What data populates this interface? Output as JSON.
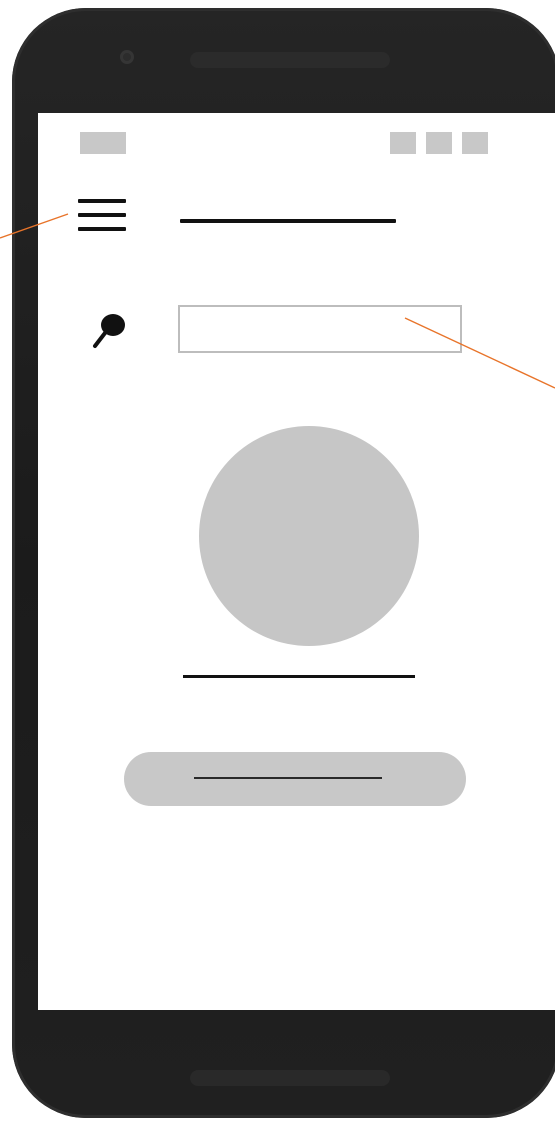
{
  "wireframe": {
    "device": "android-phone",
    "status_bar": {
      "left_indicator_count": 1,
      "right_indicator_count": 3
    },
    "header": {
      "menu_icon": "hamburger-menu-icon",
      "title_placeholder": "title-line"
    },
    "search": {
      "icon": "search-icon",
      "value": "",
      "placeholder": ""
    },
    "profile": {
      "avatar": "avatar-placeholder",
      "name_placeholder": "name-line"
    },
    "primary_button": {
      "label_placeholder": "button-label-line"
    },
    "annotations": {
      "callout_color": "#e8742a",
      "targets": [
        "menu-icon",
        "search-input"
      ]
    },
    "colors": {
      "placeholder_gray": "#c8c8c8",
      "ink": "#111111",
      "device_frame": "#1f1f1f"
    }
  }
}
